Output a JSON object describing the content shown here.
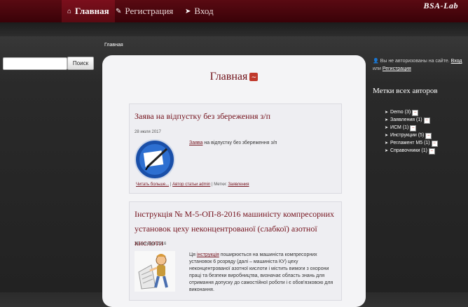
{
  "nav": {
    "items": [
      {
        "label": "Главная",
        "icon": "home-icon",
        "active": true
      },
      {
        "label": "Регистрация",
        "icon": "edit-icon",
        "active": false
      },
      {
        "label": "Вход",
        "icon": "login-icon",
        "active": false
      }
    ],
    "logo": "BSA-Lab"
  },
  "breadcrumb": "Главная",
  "search": {
    "placeholder": "",
    "button": "Поиск"
  },
  "page": {
    "title": "Главная"
  },
  "posts": [
    {
      "title": "Заява на відпустку без збереження з/п",
      "date": "28 июля 2017",
      "excerpt_link": "Заява",
      "excerpt_rest": " на відпустку без збереження з/п",
      "read_more": "Читать больше...",
      "author": "Автор статьи admin",
      "tags_label": "Метки:",
      "tag": "Заявления"
    },
    {
      "title_line1": "Інструкція № М-5-ОП-8-2016 машиністу компресорних",
      "title_line2": "установок цеху неконцентрованої (слабкої) азотної кислоти",
      "date": "26 октября 2016",
      "excerpt_pre": "Ця ",
      "excerpt_link": "інструкція",
      "excerpt_lines": [
        " поширюється на машиніста компресорних",
        "установок 6 розряду (далі – машиніста КУ) цеху",
        "неконцентрованої азотної кислоти і містить вимоги з охорони",
        "праці та безпеки виробництва, визначає область знань для",
        "отримання допуску до самостійної роботи і є обов'язковою для",
        "виконання."
      ]
    }
  ],
  "sidebar": {
    "auth_text": "Вы не авторизованы на сайте.",
    "login": "Вход",
    "or": "или",
    "register": "Регистрация",
    "tags_title": "Метки всех авторов",
    "tags": [
      {
        "name": "Demo",
        "count": "(3)"
      },
      {
        "name": "Заявления",
        "count": "(1)"
      },
      {
        "name": "ИСМ",
        "count": "(1)"
      },
      {
        "name": "Инструкции",
        "count": "(5)"
      },
      {
        "name": "Регламент М5",
        "count": "(1)"
      },
      {
        "name": "Справочники",
        "count": "(1)"
      }
    ]
  },
  "colors": {
    "brand": "#5a0a12",
    "link": "#74121c",
    "rss": "#c0392b"
  }
}
